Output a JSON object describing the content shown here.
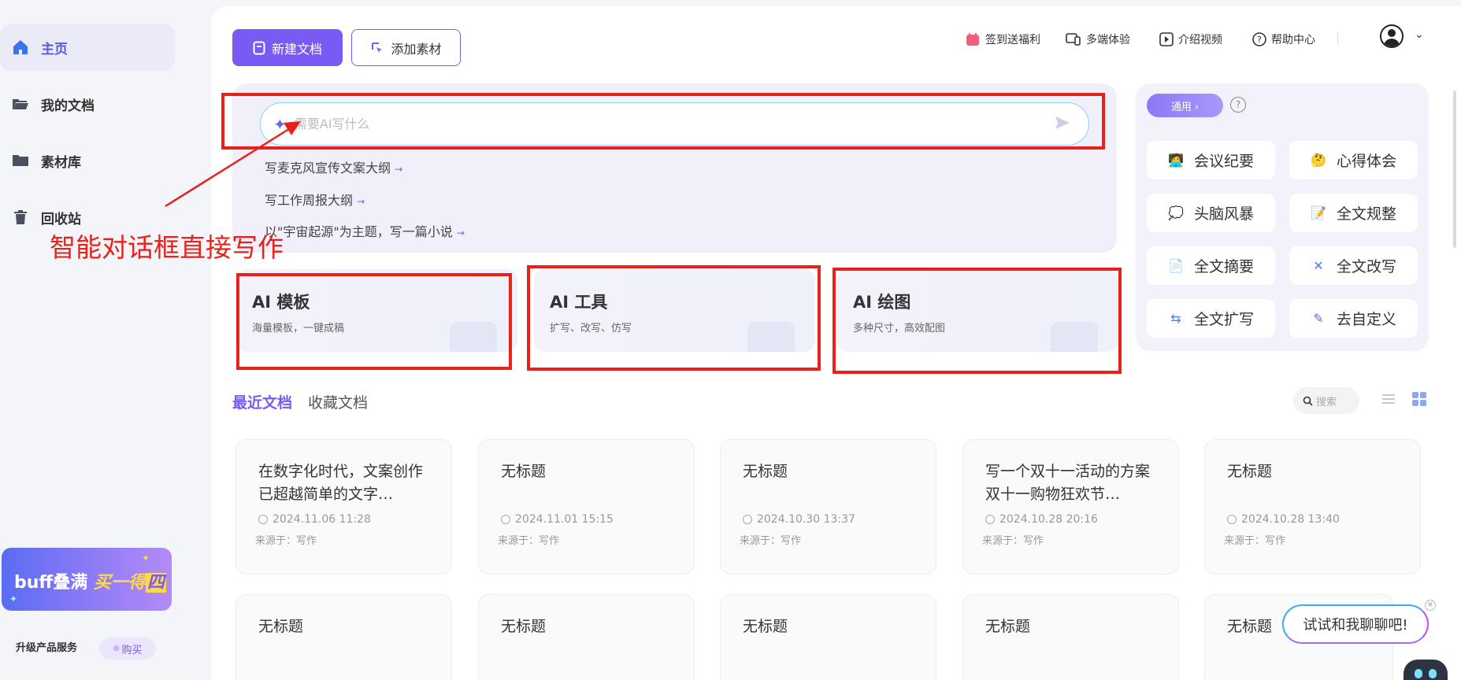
{
  "sidebar": {
    "items": [
      {
        "label": "主页",
        "icon": "home-icon",
        "active": true
      },
      {
        "label": "我的文档",
        "icon": "folder-open-icon"
      },
      {
        "label": "素材库",
        "icon": "folder-icon"
      },
      {
        "label": "回收站",
        "icon": "trash-icon"
      }
    ],
    "promo": {
      "text": "buff叠满",
      "highlight_prefix": "买一得",
      "highlight_char": "四"
    },
    "upgrade_label": "升级产品服务",
    "buy_label": "购买"
  },
  "header": {
    "new_doc_label": "新建文档",
    "add_material_label": "添加素材",
    "links": [
      {
        "label": "签到送福利",
        "icon": "calendar-gift-icon"
      },
      {
        "label": "多端体验",
        "icon": "devices-icon"
      },
      {
        "label": "介绍视频",
        "icon": "play-video-icon"
      },
      {
        "label": "帮助中心",
        "icon": "help-circle-icon"
      }
    ]
  },
  "ai_input": {
    "placeholder": "需要AI写什么",
    "suggestions": [
      "写麦克风宣传文案大纲",
      "写工作周报大纲",
      "以\"宇宙起源\"为主题，写一篇小说"
    ]
  },
  "annotation": {
    "text": "智能对话框直接写作",
    "color": "#e8211a"
  },
  "ai_cards": [
    {
      "title": "AI 模板",
      "subtitle": "海量模板，一键成稿"
    },
    {
      "title": "AI 工具",
      "subtitle": "扩写、改写、仿写"
    },
    {
      "title": "AI 绘图",
      "subtitle": "多种尺寸，高效配图"
    }
  ],
  "tools": {
    "category_label": "通用 ›",
    "items": [
      {
        "label": "会议纪要",
        "icon": "meeting-person-icon"
      },
      {
        "label": "心得体会",
        "icon": "thinking-face-icon"
      },
      {
        "label": "头脑风暴",
        "icon": "brainstorm-icon"
      },
      {
        "label": "全文规整",
        "icon": "document-format-icon"
      },
      {
        "label": "全文摘要",
        "icon": "document-summary-icon"
      },
      {
        "label": "全文改写",
        "icon": "rewrite-icon"
      },
      {
        "label": "全文扩写",
        "icon": "expand-icon"
      },
      {
        "label": "去自定义",
        "icon": "pencil-icon"
      }
    ]
  },
  "docs": {
    "tabs": [
      "最近文档",
      "收藏文档"
    ],
    "search_placeholder": "搜索",
    "items": [
      {
        "title": "在数字化时代，文案创作已超越简单的文字…",
        "date": "2024.11.06 11:28",
        "source": "来源于：写作"
      },
      {
        "title": "无标题",
        "date": "2024.11.01 15:15",
        "source": "来源于：写作"
      },
      {
        "title": "无标题",
        "date": "2024.10.30 13:37",
        "source": "来源于：写作"
      },
      {
        "title": "写一个双十一活动的方案双十一购物狂欢节…",
        "date": "2024.10.28 20:16",
        "source": "来源于：写作"
      },
      {
        "title": "无标题",
        "date": "2024.10.28 13:40",
        "source": "来源于：写作"
      },
      {
        "title": "无标题"
      },
      {
        "title": "无标题"
      },
      {
        "title": "无标题"
      },
      {
        "title": "无标题"
      },
      {
        "title": "无标题"
      }
    ]
  },
  "chat_bubble": {
    "label": "试试和我聊聊吧!"
  },
  "colors": {
    "accent": "#7a5af5",
    "annotation": "#e8211a",
    "link_blue": "#3ea9f5"
  }
}
